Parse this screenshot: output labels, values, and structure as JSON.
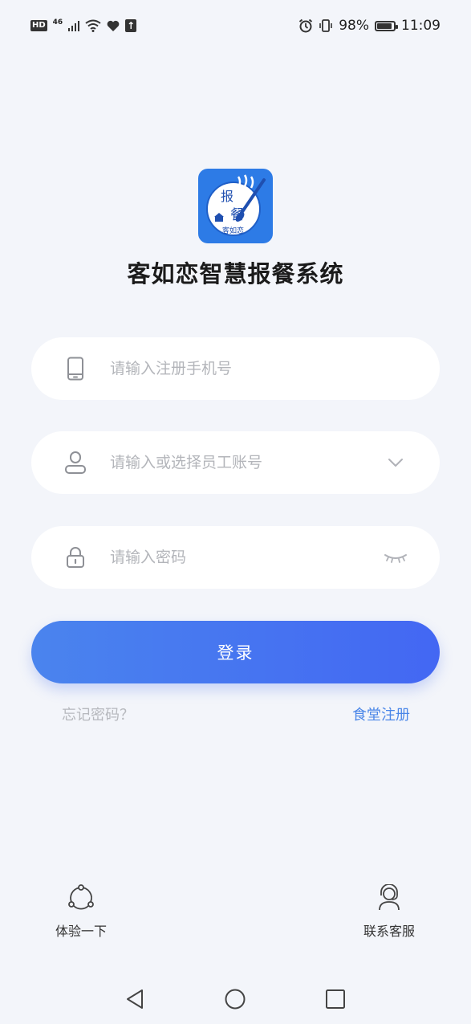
{
  "status_bar": {
    "hd": "HD",
    "network": "46",
    "battery_percent": "98%",
    "battery_level": 0.98,
    "time": "11:09"
  },
  "app": {
    "title": "客如恋智慧报餐系统",
    "logo_text_main": "报",
    "logo_text_sub": "餐",
    "logo_text_bottom": "客如恋",
    "brand_color": "#2d7be6"
  },
  "form": {
    "phone_placeholder": "请输入注册手机号",
    "phone_value": "",
    "account_placeholder": "请输入或选择员工账号",
    "account_value": "",
    "password_placeholder": "请输入密码",
    "password_value": "",
    "login_label": "登录",
    "forgot_label": "忘记密码？",
    "register_label": "食堂注册",
    "accent_color": "#4a86e8"
  },
  "bottom": {
    "try_label": "体验一下",
    "support_label": "联系客服"
  },
  "icons": {
    "phone": "phone-icon",
    "user": "user-icon",
    "lock": "lock-icon",
    "dropdown": "chevron-down-icon",
    "eye_closed": "eye-closed-icon",
    "share": "share-icon",
    "headset": "headset-icon"
  }
}
